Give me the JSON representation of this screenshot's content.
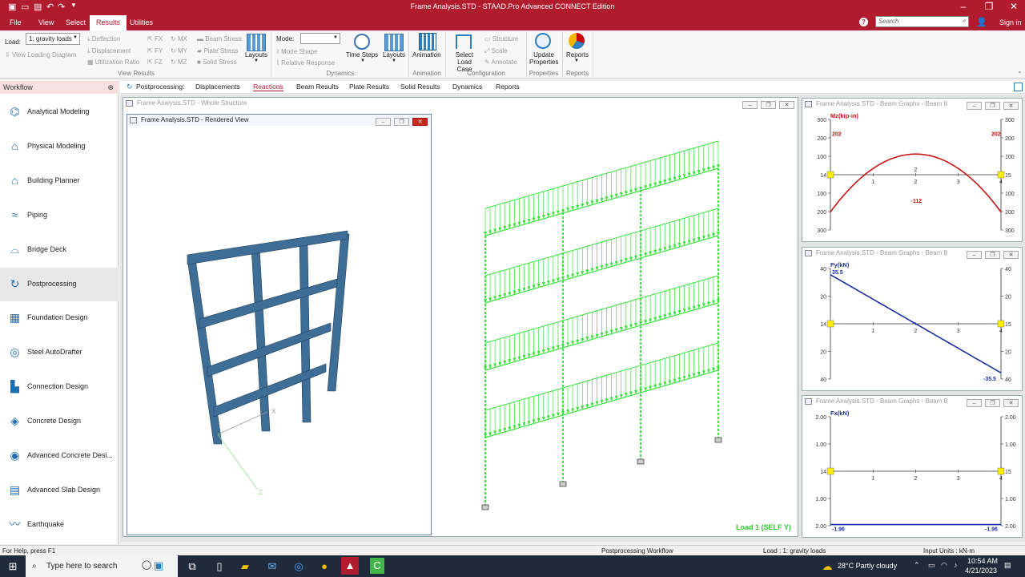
{
  "window": {
    "title": "Frame Analysis.STD - STAAD.Pro Advanced CONNECT Edition"
  },
  "menu": {
    "items": [
      "File",
      "View",
      "Select",
      "Results",
      "Utilities"
    ],
    "active": "Results"
  },
  "search": {
    "placeholder": "Search"
  },
  "signin": "Sign in",
  "ribbon": {
    "load_label": "Load:",
    "load_value": "1: gravity loads",
    "view_loading_diagram": "View Loading Diagram",
    "deflection": "Deflection",
    "displacement": "Displacement",
    "utilization_ratio": "Utilization Ratio",
    "fx": "FX",
    "fy": "FY",
    "fz": "FZ",
    "mx": "MX",
    "my": "MY",
    "mz": "MZ",
    "beam_stress": "Beam Stress",
    "plate_stress": "Plate Stress",
    "solid_stress": "Solid Stress",
    "layouts": "Layouts",
    "mode_label": "Mode:",
    "mode_shape": "Mode Shape",
    "relative_response": "Relative Response",
    "time_steps": "Time Steps",
    "layouts2": "Layouts",
    "animation": "Animation",
    "select_load_case": "Select Load Case",
    "structure": "Structure",
    "scale": "Scale",
    "annotate": "Annotate",
    "update_properties": "Update Properties",
    "reports": "Reports",
    "groups": {
      "view_results": "View Results",
      "dynamics": "Dynamics",
      "animation": "Animation",
      "configuration": "Configuration",
      "properties": "Properties",
      "reports": "Reports"
    }
  },
  "workflow": {
    "title": "Workflow",
    "items": [
      {
        "label": "Analytical Modeling",
        "icon": "analytical-modeling-icon"
      },
      {
        "label": "Physical Modeling",
        "icon": "physical-modeling-icon"
      },
      {
        "label": "Building Planner",
        "icon": "building-planner-icon"
      },
      {
        "label": "Piping",
        "icon": "piping-icon"
      },
      {
        "label": "Bridge Deck",
        "icon": "bridge-deck-icon"
      },
      {
        "label": "Postprocessing",
        "icon": "postprocessing-icon"
      },
      {
        "label": "Foundation Design",
        "icon": "foundation-design-icon"
      },
      {
        "label": "Steel AutoDrafter",
        "icon": "steel-autodrafter-icon"
      },
      {
        "label": "Connection Design",
        "icon": "connection-design-icon"
      },
      {
        "label": "Concrete Design",
        "icon": "concrete-design-icon"
      },
      {
        "label": "Advanced Concrete Desi...",
        "icon": "advanced-concrete-icon"
      },
      {
        "label": "Advanced Slab Design",
        "icon": "advanced-slab-icon"
      },
      {
        "label": "Earthquake",
        "icon": "earthquake-icon"
      }
    ],
    "active": "Postprocessing"
  },
  "pptabs": {
    "label": "Postprocessing:",
    "items": [
      "Displacements",
      "Reactions",
      "Beam Results",
      "Plate Results",
      "Solid Results",
      "Dynamics",
      "Reports"
    ],
    "active": "Reactions"
  },
  "windows": {
    "whole": "Frame Analysis.STD - Whole Structure",
    "rendered": "Frame Analysis.STD - Rendered View",
    "graph1": "Frame Analysis.STD - Beam Graphs - Beam 8",
    "graph2": "Frame Analysis.STD - Beam Graphs - Beam 8",
    "graph3": "Frame Analysis.STD - Beam Graphs - Beam 8",
    "load_caption": "Load 1 (SELF Y)"
  },
  "graphs": {
    "mz": {
      "title": "Mz(kip-in)",
      "left_ticks": [
        "300",
        "200",
        "100",
        "14",
        "100",
        "200",
        "300"
      ],
      "right_ticks": [
        "300",
        "200",
        "100",
        "15",
        "100",
        "200",
        "300"
      ],
      "x_ticks": [
        "1",
        "2",
        "3",
        "4"
      ],
      "start_label": "202",
      "end_label": "202",
      "min_label": "-112",
      "mid_label": "2"
    },
    "fy": {
      "title": "Fy(kN)",
      "left_ticks": [
        "40",
        "20",
        "14",
        "20",
        "40"
      ],
      "right_ticks": [
        "40",
        "20",
        "15",
        "20",
        "40"
      ],
      "x_ticks": [
        "1",
        "2",
        "3",
        "4"
      ],
      "start_label": "35.5",
      "end_label": "-35.5"
    },
    "fx": {
      "title": "Fx(kN)",
      "left_ticks": [
        "2.00",
        "1.00",
        "14",
        "1.00",
        "2.00"
      ],
      "right_ticks": [
        "2.00",
        "1.00",
        "15",
        "1.00",
        "2.00"
      ],
      "x_ticks": [
        "1",
        "2",
        "3",
        "4"
      ],
      "start_label": "-1.96",
      "end_label": "-1.96"
    }
  },
  "status": {
    "help": "For Help, press F1",
    "workflow": "Postprocessing Workflow",
    "load": "Load : 1: gravity loads",
    "units": "Input Units : kN-m"
  },
  "taskbar": {
    "search": "Type here to search",
    "weather": "28°C  Partly cloudy",
    "time": "10:54 AM",
    "date": "4/21/2023"
  }
}
